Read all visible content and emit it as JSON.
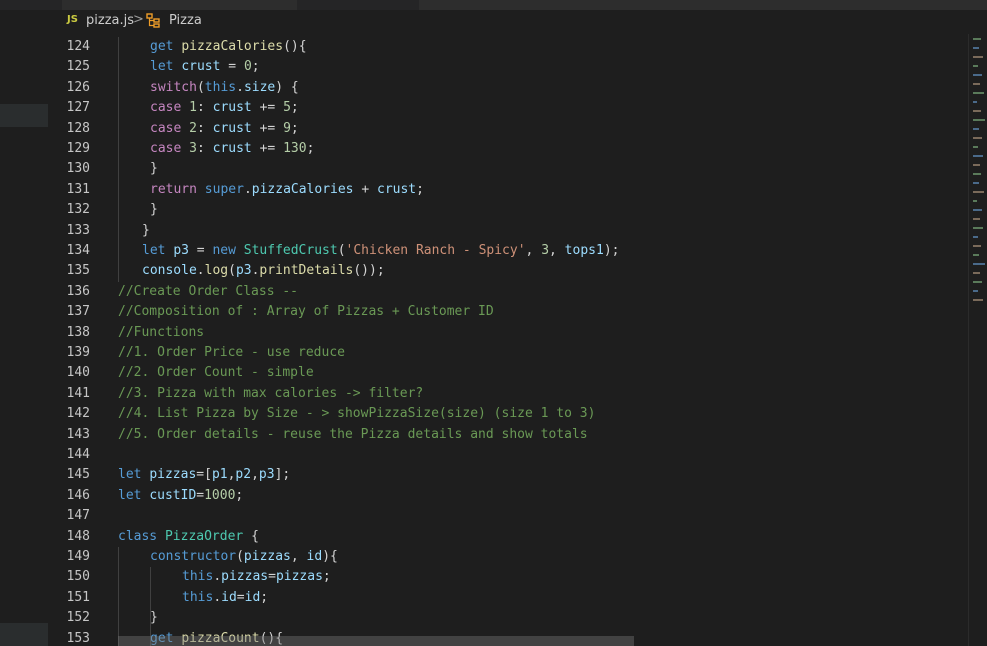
{
  "breadcrumb": {
    "file_icon": "JS",
    "file": "pizza.js",
    "separator": ">",
    "symbol_icon": "class-icon",
    "symbol": "Pizza"
  },
  "colors": {
    "background": "#1e1e1e",
    "keyword": "#569cd6",
    "control": "#c586c0",
    "variable": "#9cdcfe",
    "function": "#dcdcaa",
    "class": "#4ec9b0",
    "number": "#b5cea8",
    "string": "#ce9178",
    "comment": "#6a9955"
  },
  "code_lines": [
    {
      "n": "124",
      "indent": 2,
      "tokens": [
        [
          "kw",
          "get "
        ],
        [
          "fn",
          "pizzaCalories"
        ],
        [
          "pun",
          "(){"
        ]
      ]
    },
    {
      "n": "125",
      "indent": 2,
      "tokens": [
        [
          "kw",
          "let "
        ],
        [
          "var",
          "crust"
        ],
        [
          "pun",
          " = "
        ],
        [
          "num",
          "0"
        ],
        [
          "pun",
          ";"
        ]
      ]
    },
    {
      "n": "126",
      "indent": 2,
      "tokens": [
        [
          "ctl",
          "switch"
        ],
        [
          "pun",
          "("
        ],
        [
          "kw",
          "this"
        ],
        [
          "pun",
          "."
        ],
        [
          "var",
          "size"
        ],
        [
          "pun",
          ") {"
        ]
      ]
    },
    {
      "n": "127",
      "indent": 2,
      "tokens": [
        [
          "ctl",
          "case "
        ],
        [
          "num",
          "1"
        ],
        [
          "pun",
          ": "
        ],
        [
          "var",
          "crust"
        ],
        [
          "pun",
          " += "
        ],
        [
          "num",
          "5"
        ],
        [
          "pun",
          ";"
        ]
      ]
    },
    {
      "n": "128",
      "indent": 2,
      "tokens": [
        [
          "ctl",
          "case "
        ],
        [
          "num",
          "2"
        ],
        [
          "pun",
          ": "
        ],
        [
          "var",
          "crust"
        ],
        [
          "pun",
          " += "
        ],
        [
          "num",
          "9"
        ],
        [
          "pun",
          ";"
        ]
      ]
    },
    {
      "n": "129",
      "indent": 2,
      "tokens": [
        [
          "ctl",
          "case "
        ],
        [
          "num",
          "3"
        ],
        [
          "pun",
          ": "
        ],
        [
          "var",
          "crust"
        ],
        [
          "pun",
          " += "
        ],
        [
          "num",
          "130"
        ],
        [
          "pun",
          ";"
        ]
      ]
    },
    {
      "n": "130",
      "indent": 2,
      "tokens": [
        [
          "pun",
          "}"
        ]
      ]
    },
    {
      "n": "131",
      "indent": 2,
      "tokens": [
        [
          "ctl",
          "return "
        ],
        [
          "kw",
          "super"
        ],
        [
          "pun",
          "."
        ],
        [
          "var",
          "pizzaCalories"
        ],
        [
          "pun",
          " + "
        ],
        [
          "var",
          "crust"
        ],
        [
          "pun",
          ";"
        ]
      ]
    },
    {
      "n": "132",
      "indent": 2,
      "tokens": [
        [
          "pun",
          "}"
        ]
      ]
    },
    {
      "n": "133",
      "indent": 1,
      "tokens": [
        [
          "pun",
          "}"
        ]
      ]
    },
    {
      "n": "134",
      "indent": 1,
      "tokens": [
        [
          "kw",
          "let "
        ],
        [
          "var",
          "p3"
        ],
        [
          "pun",
          " = "
        ],
        [
          "kw",
          "new "
        ],
        [
          "cls",
          "StuffedCrust"
        ],
        [
          "pun",
          "("
        ],
        [
          "str",
          "'Chicken Ranch - Spicy'"
        ],
        [
          "pun",
          ", "
        ],
        [
          "num",
          "3"
        ],
        [
          "pun",
          ", "
        ],
        [
          "var",
          "tops1"
        ],
        [
          "pun",
          ");"
        ]
      ]
    },
    {
      "n": "135",
      "indent": 1,
      "tokens": [
        [
          "var",
          "console"
        ],
        [
          "pun",
          "."
        ],
        [
          "fn",
          "log"
        ],
        [
          "pun",
          "("
        ],
        [
          "var",
          "p3"
        ],
        [
          "pun",
          "."
        ],
        [
          "fn",
          "printDetails"
        ],
        [
          "pun",
          "());"
        ]
      ]
    },
    {
      "n": "136",
      "indent": 0,
      "tokens": [
        [
          "com",
          "//Create Order Class --"
        ]
      ]
    },
    {
      "n": "137",
      "indent": 0,
      "tokens": [
        [
          "com",
          "//Composition of : Array of Pizzas + Customer ID"
        ]
      ]
    },
    {
      "n": "138",
      "indent": 0,
      "tokens": [
        [
          "com",
          "//Functions"
        ]
      ]
    },
    {
      "n": "139",
      "indent": 0,
      "tokens": [
        [
          "com",
          "//1. Order Price - use reduce"
        ]
      ]
    },
    {
      "n": "140",
      "indent": 0,
      "tokens": [
        [
          "com",
          "//2. Order Count - simple"
        ]
      ]
    },
    {
      "n": "141",
      "indent": 0,
      "tokens": [
        [
          "com",
          "//3. Pizza with max calories -> filter?"
        ]
      ]
    },
    {
      "n": "142",
      "indent": 0,
      "tokens": [
        [
          "com",
          "//4. List Pizza by Size - > showPizzaSize(size) (size 1 to 3)"
        ]
      ]
    },
    {
      "n": "143",
      "indent": 0,
      "tokens": [
        [
          "com",
          "//5. Order details - reuse the Pizza details and show totals"
        ]
      ]
    },
    {
      "n": "144",
      "indent": 0,
      "tokens": []
    },
    {
      "n": "145",
      "indent": 0,
      "tokens": [
        [
          "kw",
          "let "
        ],
        [
          "var",
          "pizzas"
        ],
        [
          "pun",
          "=["
        ],
        [
          "var",
          "p1"
        ],
        [
          "pun",
          ","
        ],
        [
          "var",
          "p2"
        ],
        [
          "pun",
          ","
        ],
        [
          "var",
          "p3"
        ],
        [
          "pun",
          "];"
        ]
      ]
    },
    {
      "n": "146",
      "indent": 0,
      "tokens": [
        [
          "kw",
          "let "
        ],
        [
          "var",
          "custID"
        ],
        [
          "pun",
          "="
        ],
        [
          "num",
          "1000"
        ],
        [
          "pun",
          ";"
        ]
      ]
    },
    {
      "n": "147",
      "indent": 0,
      "tokens": []
    },
    {
      "n": "148",
      "indent": 0,
      "tokens": [
        [
          "kw",
          "class "
        ],
        [
          "cls",
          "PizzaOrder"
        ],
        [
          "pun",
          " {"
        ]
      ]
    },
    {
      "n": "149",
      "indent": 2,
      "tokens": [
        [
          "kw",
          "constructor"
        ],
        [
          "pun",
          "("
        ],
        [
          "var",
          "pizzas"
        ],
        [
          "pun",
          ", "
        ],
        [
          "var",
          "id"
        ],
        [
          "pun",
          "){"
        ]
      ]
    },
    {
      "n": "150",
      "indent": 4,
      "tokens": [
        [
          "kw",
          "this"
        ],
        [
          "pun",
          "."
        ],
        [
          "var",
          "pizzas"
        ],
        [
          "pun",
          "="
        ],
        [
          "var",
          "pizzas"
        ],
        [
          "pun",
          ";"
        ]
      ]
    },
    {
      "n": "151",
      "indent": 4,
      "tokens": [
        [
          "kw",
          "this"
        ],
        [
          "pun",
          "."
        ],
        [
          "var",
          "id"
        ],
        [
          "pun",
          "="
        ],
        [
          "var",
          "id"
        ],
        [
          "pun",
          ";"
        ]
      ]
    },
    {
      "n": "152",
      "indent": 2,
      "tokens": [
        [
          "pun",
          "}"
        ]
      ]
    },
    {
      "n": "153",
      "indent": 2,
      "tokens": [
        [
          "kw",
          "get "
        ],
        [
          "fn",
          "pizzaCount"
        ],
        [
          "pun",
          "(){"
        ]
      ]
    }
  ]
}
